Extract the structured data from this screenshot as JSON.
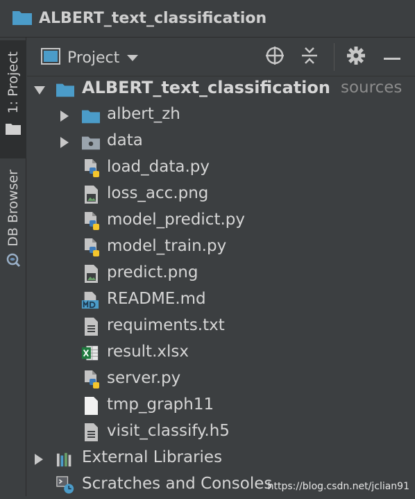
{
  "window": {
    "title": "ALBERT_text_classification"
  },
  "stripe": {
    "project_tab": "1: Project",
    "db_tab": "DB Browser"
  },
  "toolbar": {
    "view_label": "Project"
  },
  "tree": {
    "root": {
      "label": "ALBERT_text_classification",
      "suffix": "sources"
    },
    "items": [
      {
        "label": "albert_zh",
        "icon": "folder-icon"
      },
      {
        "label": "data",
        "icon": "folder-dot-icon"
      },
      {
        "label": "load_data.py",
        "icon": "python-file-icon"
      },
      {
        "label": "loss_acc.png",
        "icon": "image-file-icon"
      },
      {
        "label": "model_predict.py",
        "icon": "python-file-icon"
      },
      {
        "label": "model_train.py",
        "icon": "python-file-icon"
      },
      {
        "label": "predict.png",
        "icon": "image-file-icon"
      },
      {
        "label": "README.md",
        "icon": "markdown-file-icon"
      },
      {
        "label": "requiments.txt",
        "icon": "text-file-icon"
      },
      {
        "label": "result.xlsx",
        "icon": "excel-file-icon"
      },
      {
        "label": "server.py",
        "icon": "python-file-icon"
      },
      {
        "label": "tmp_graph11",
        "icon": "plain-file-icon"
      },
      {
        "label": "visit_classify.h5",
        "icon": "text-file-icon"
      }
    ],
    "external": {
      "label": "External Libraries"
    },
    "scratches": {
      "label": "Scratches and Consoles"
    }
  },
  "watermark": "https://blog.csdn.net/jclian91",
  "colors": {
    "background": "#3c3f41",
    "folder": "#4b9cc9",
    "text": "#d6d6d6",
    "muted": "#8c8c8c"
  }
}
